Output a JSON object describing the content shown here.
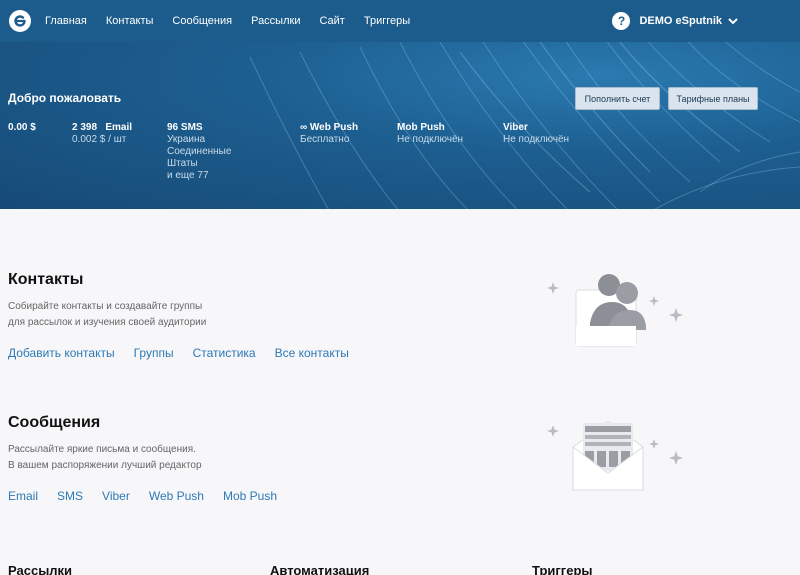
{
  "nav": {
    "items": [
      "Главная",
      "Контакты",
      "Сообщения",
      "Рассылки",
      "Сайт",
      "Триггеры"
    ],
    "help": "?",
    "user": "DEMO eSputnik"
  },
  "hero": {
    "welcome": "Добро пожаловать",
    "topup_label": "Пополнить счет",
    "plans_label": "Тарифные планы",
    "stats": {
      "balance": "0.00 $",
      "email_count": "2 398",
      "email_label": "Email",
      "email_price": "0.002 $ / шт",
      "sms_head": "96 SMS",
      "sms_country_1": "Украина",
      "sms_country_2": "Соединенные",
      "sms_country_3": "Штаты",
      "sms_more": "и еще 77",
      "webpush_head": "∞ Web Push",
      "webpush_sub": "Бесплатно",
      "mobpush_head": "Mob Push",
      "mobpush_sub": "Не подключён",
      "viber_head": "Viber",
      "viber_sub": "Не подключён"
    }
  },
  "contacts": {
    "title": "Контакты",
    "desc_1": "Собирайте контакты и создавайте группы",
    "desc_2": "для рассылок и изучения своей аудитории",
    "links": [
      "Добавить контакты",
      "Группы",
      "Статистика",
      "Все контакты"
    ]
  },
  "messages": {
    "title": "Сообщения",
    "desc_1": "Рассылайте яркие письма и сообщения.",
    "desc_2": "В вашем распоряжении лучший редактор",
    "links": [
      "Email",
      "SMS",
      "Viber",
      "Web Push",
      "Mob Push"
    ]
  },
  "bottom": {
    "mailings": "Рассылки",
    "automation": "Автоматизация",
    "triggers": "Триггеры"
  },
  "colors": {
    "nav_bg": "#1c5c8c",
    "link": "#2d79b5",
    "page_bg": "#f7f7fa"
  }
}
